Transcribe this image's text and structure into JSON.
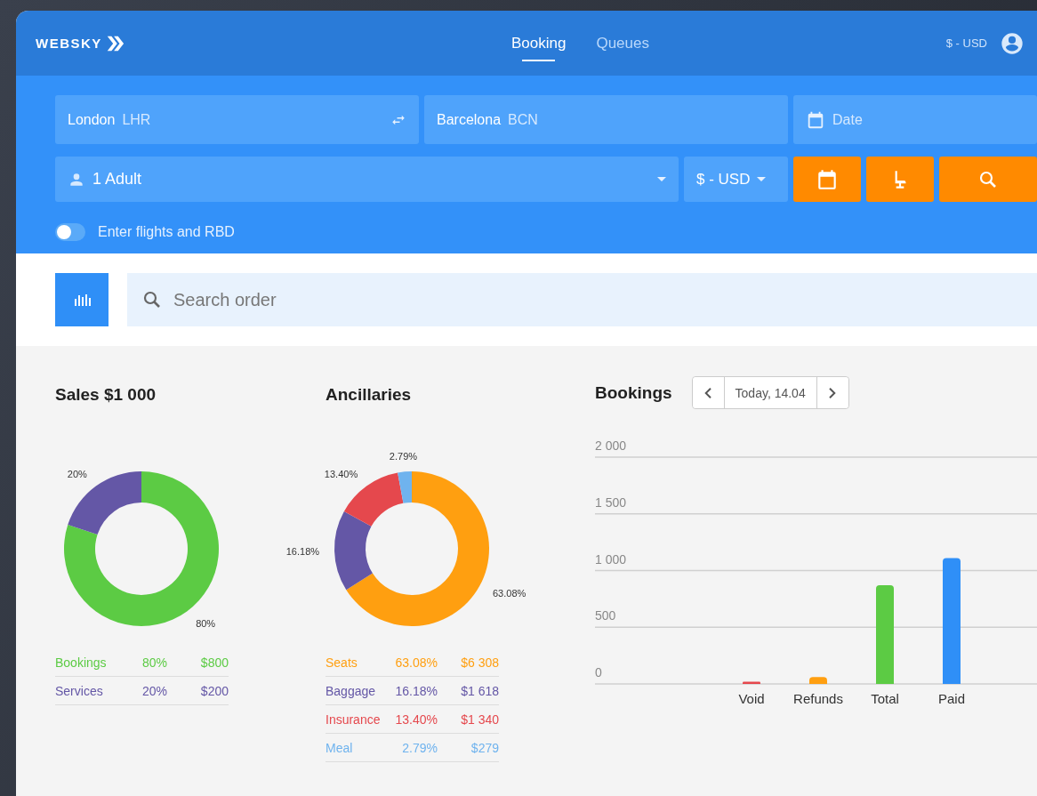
{
  "header": {
    "logo": "WEBSKY",
    "tabs": [
      {
        "label": "Booking",
        "selected": true
      },
      {
        "label": "Queues",
        "selected": false
      }
    ],
    "currency": "$ - USD"
  },
  "search_form": {
    "origin": {
      "city": "London",
      "code": "LHR"
    },
    "destination": {
      "city": "Barcelona",
      "code": "BCN"
    },
    "date": {
      "placeholder": "Date"
    },
    "passengers": "1 Adult",
    "currency": "$ - USD",
    "toggle": {
      "label": "Enter flights and RBD",
      "on": false
    }
  },
  "order_search": {
    "placeholder": "Search order"
  },
  "sales": {
    "title": "Sales $1 000",
    "chart_data": {
      "type": "donut",
      "categories": [
        "Bookings",
        "Services"
      ],
      "values": [
        80,
        20
      ],
      "value_labels": [
        "80%",
        "20%"
      ]
    },
    "legend": [
      {
        "percent": "80%",
        "amount": "$800",
        "color": "#5ccb44"
      },
      {
        "percent": "20%",
        "amount": "$200",
        "color": "#6457a6"
      }
    ]
  },
  "ancillaries": {
    "title": "Ancillaries",
    "chart_data": {
      "type": "donut",
      "categories": [
        "Seats",
        "Baggage",
        "Insurance",
        "Meal"
      ],
      "values": [
        63.08,
        16.18,
        13.4,
        2.79
      ],
      "value_labels": [
        "63.08%",
        "16.18%",
        "13.40%",
        "2.79%"
      ]
    },
    "legend": [
      {
        "percent": "63.08%",
        "amount": "$6 308",
        "color": "#ff9f10"
      },
      {
        "percent": "16.18%",
        "amount": "$1 618",
        "color": "#6457a6"
      },
      {
        "percent": "13.40%",
        "amount": "$1 340",
        "color": "#e5484d"
      },
      {
        "percent": "2.79%",
        "amount": "$279",
        "color": "#6fb3ee"
      }
    ]
  },
  "bookings": {
    "title": "Bookings",
    "date_label": "Today, 14.04",
    "chart_data": {
      "type": "bar",
      "categories": [
        "Void",
        "Refunds",
        "Total",
        "Paid"
      ],
      "colors": [
        "#e5484d",
        "#ff9f10",
        "#5ccb44",
        "#2f8ff7"
      ],
      "values": [
        20,
        60,
        870,
        1110
      ],
      "grid": true,
      "ylim": [
        0,
        2000
      ],
      "yticks": [
        {
          "value": 0,
          "label": "0"
        },
        {
          "value": 500,
          "label": "500"
        },
        {
          "value": 1000,
          "label": "1 000"
        },
        {
          "value": 1500,
          "label": "1 500"
        },
        {
          "value": 2000,
          "label": "2 000"
        }
      ]
    }
  }
}
